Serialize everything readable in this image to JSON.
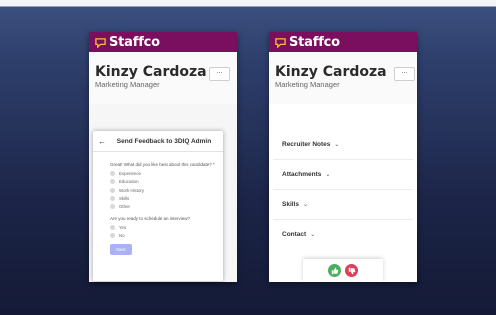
{
  "left_screen": {
    "brand": "Staffco",
    "profile": {
      "name": "Kinzy Cardoza",
      "role": "Marketing Manager",
      "more_label": "..."
    },
    "modal": {
      "title": "Send Feedback to 3DIQ Admin",
      "question1": "Great! What did you like best about this candidate? *",
      "options": [
        "Experience",
        "Education",
        "Work History",
        "Skills",
        "Other"
      ],
      "question2": "Are you ready to schedule an interview?",
      "answers": [
        "Yes",
        "No"
      ],
      "next_label": "Next"
    }
  },
  "right_screen": {
    "brand": "Staffco",
    "profile": {
      "name": "Kinzy Cardoza",
      "role": "Marketing Manager",
      "more_label": "..."
    },
    "sections": [
      "Recruiter Notes",
      "Attachments",
      "Skills",
      "Contact"
    ],
    "actions": {
      "approve_icon": "thumbs-up-icon",
      "reject_icon": "thumbs-down-icon"
    }
  },
  "colors": {
    "brand": "#7b0f5f",
    "approve": "#4caf5f",
    "reject": "#d9435a",
    "next_button": "#aab1f5"
  }
}
